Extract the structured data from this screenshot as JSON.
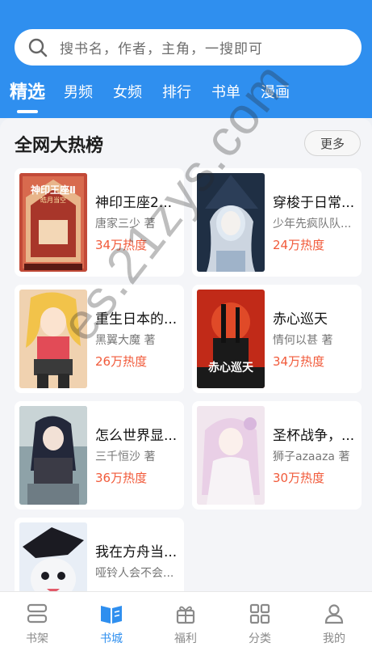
{
  "search": {
    "placeholder": "搜书名，作者，主角，一搜即可",
    "icon": "search-icon"
  },
  "tabs": [
    {
      "label": "精选",
      "active": true
    },
    {
      "label": "男频"
    },
    {
      "label": "女频"
    },
    {
      "label": "排行"
    },
    {
      "label": "书单"
    },
    {
      "label": "漫画"
    }
  ],
  "section": {
    "title": "全网大热榜",
    "more_label": "更多"
  },
  "books": [
    {
      "title": "神印王座2...",
      "author": "唐家三少 著",
      "heat": "34万热度"
    },
    {
      "title": "穿梭于日常...",
      "author": "少年先疯队队...",
      "heat": "24万热度"
    },
    {
      "title": "重生日本的...",
      "author": "黑翼大魔 著",
      "heat": "26万热度"
    },
    {
      "title": "赤心巡天",
      "author": "情何以甚 著",
      "heat": "34万热度"
    },
    {
      "title": "怎么世界显...",
      "author": "三千恒沙 著",
      "heat": "36万热度"
    },
    {
      "title": "圣杯战争，...",
      "author": "狮子azaaza 著",
      "heat": "30万热度"
    },
    {
      "title": "我在方舟当...",
      "author": "哑铃人会不会...",
      "heat": ""
    }
  ],
  "covers": {
    "book1_title": "神印王座Ⅱ",
    "book1_subtitle": "皓月当空",
    "book4_title": "赤心巡天"
  },
  "bottom_nav": [
    {
      "label": "书架",
      "icon": "bookshelf-icon"
    },
    {
      "label": "书城",
      "icon": "bookstore-icon",
      "active": true
    },
    {
      "label": "福利",
      "icon": "gift-icon"
    },
    {
      "label": "分类",
      "icon": "category-grid-icon"
    },
    {
      "label": "我的",
      "icon": "profile-icon"
    }
  ],
  "watermark": "es.21zys.com",
  "colors": {
    "primary": "#2f8fef",
    "heat": "#f15a3a",
    "background": "#eef1f6"
  }
}
